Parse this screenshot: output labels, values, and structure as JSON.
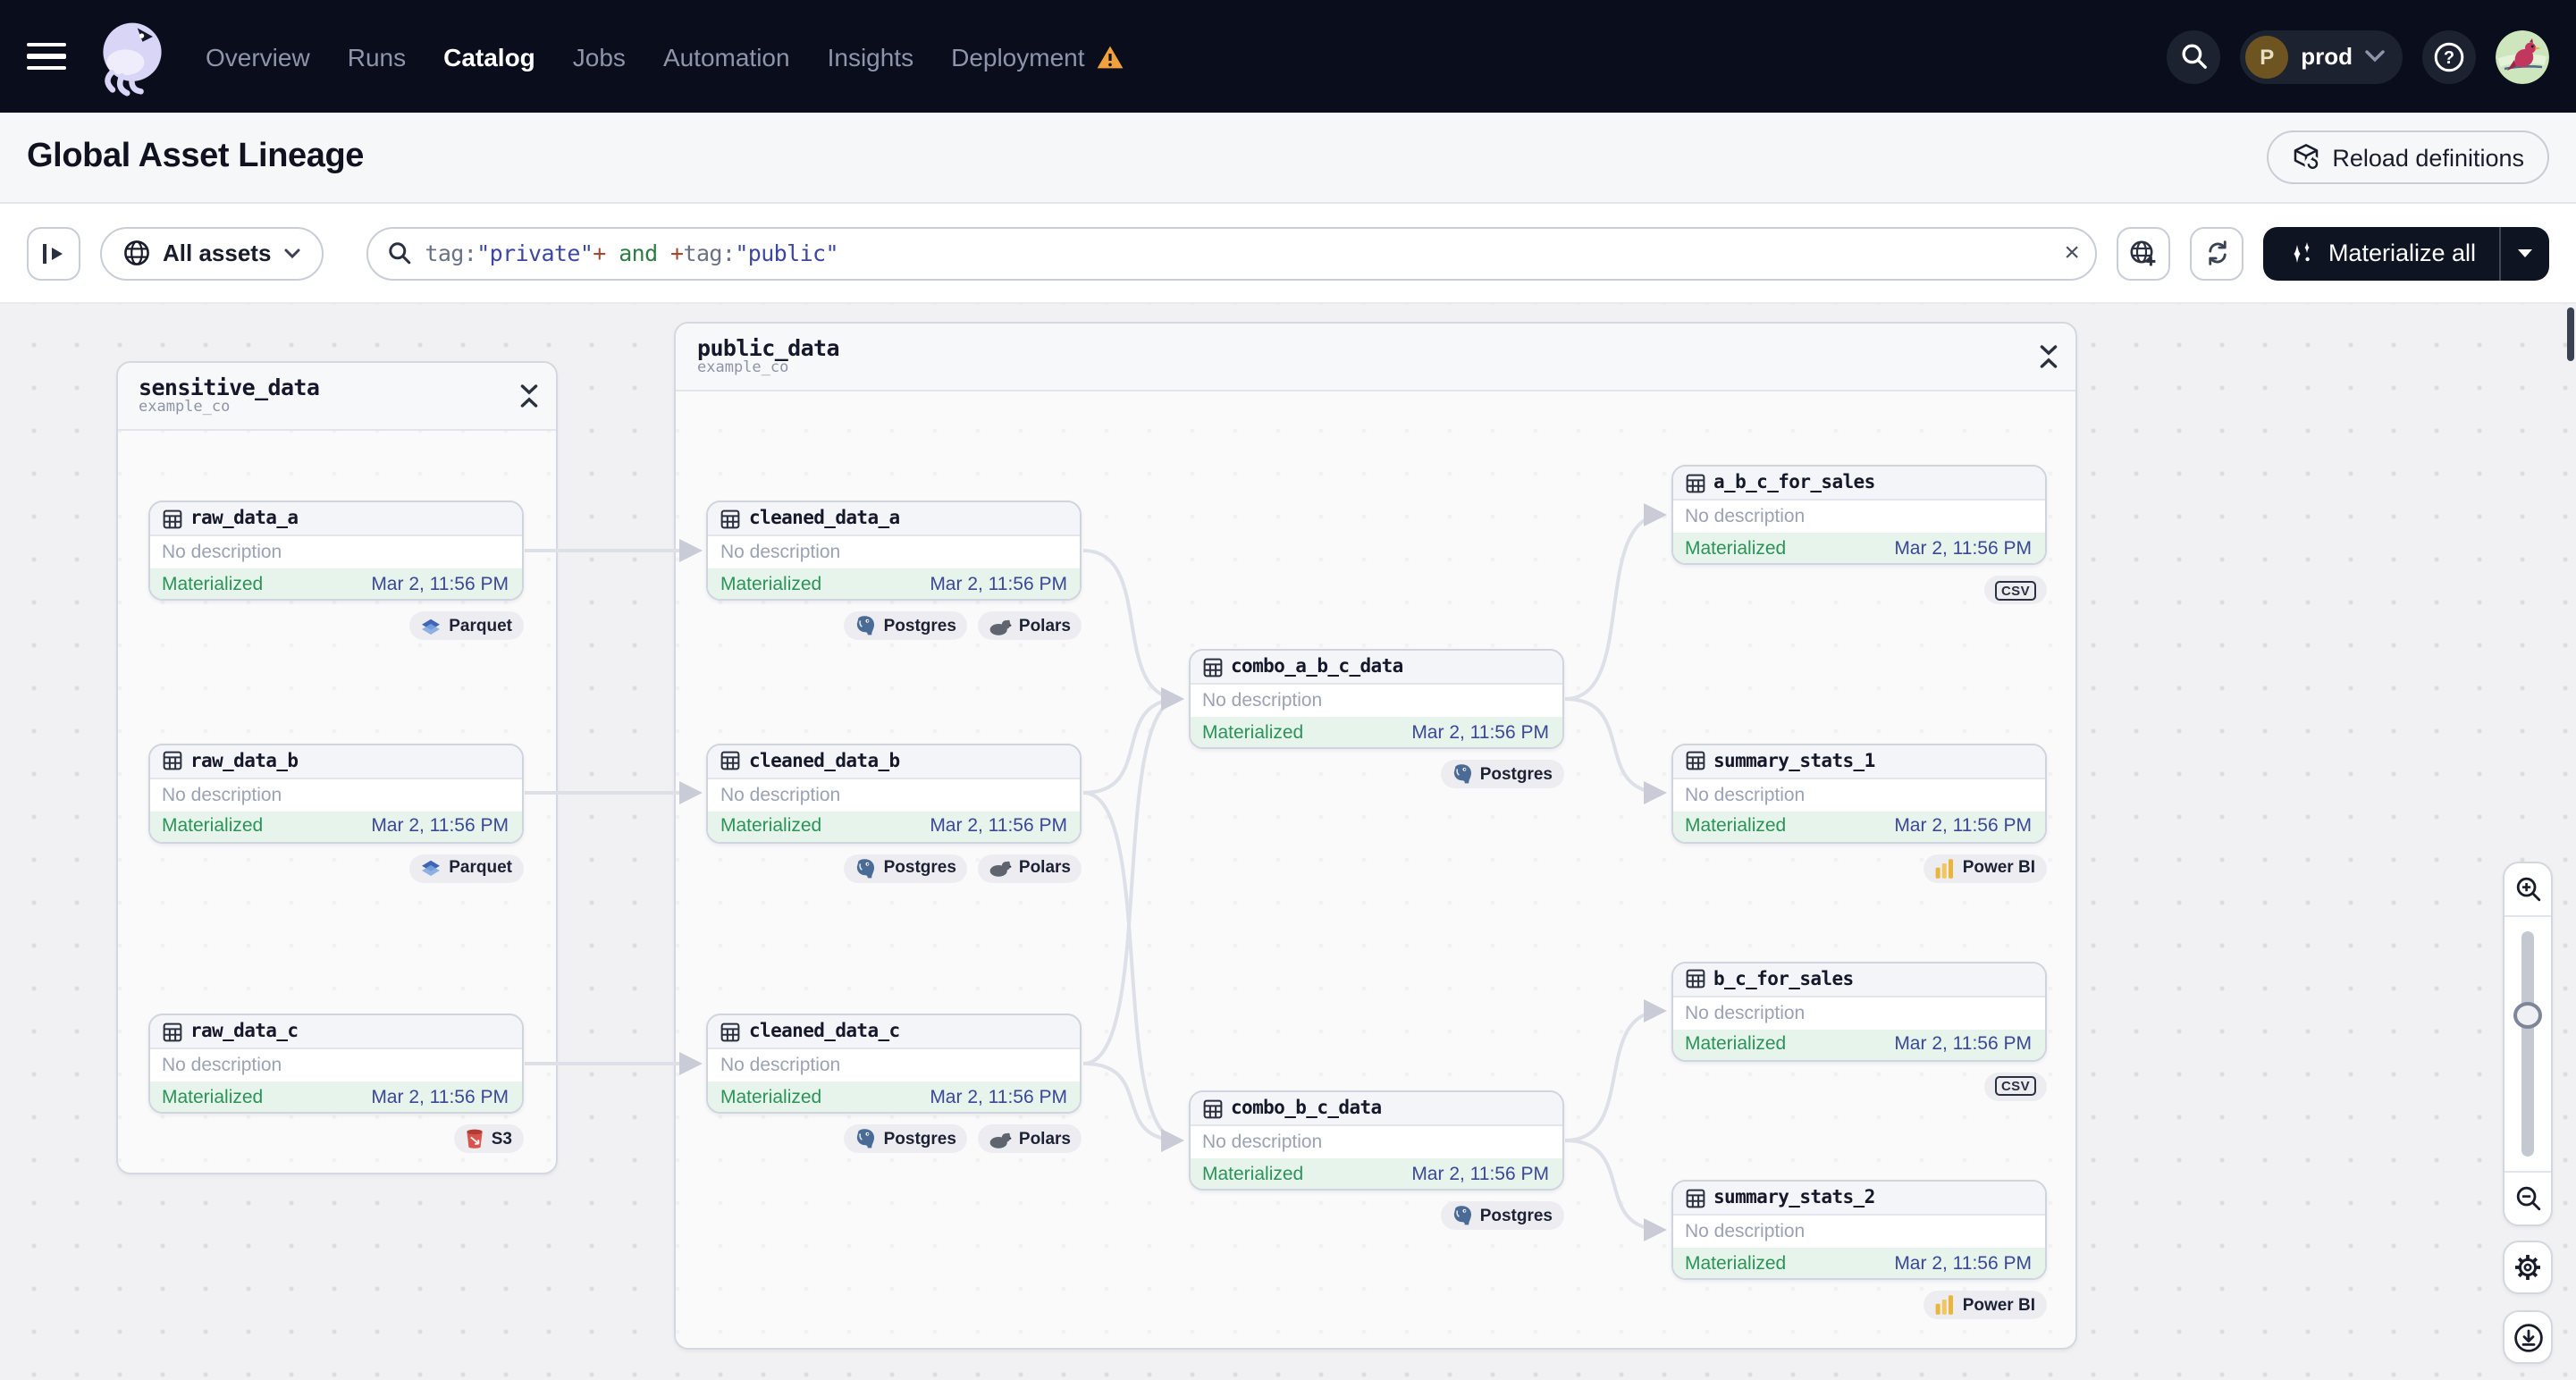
{
  "nav": {
    "menu": [
      {
        "label": "Overview"
      },
      {
        "label": "Runs"
      },
      {
        "label": "Catalog",
        "active": true
      },
      {
        "label": "Jobs"
      },
      {
        "label": "Automation"
      },
      {
        "label": "Insights"
      },
      {
        "label": "Deployment",
        "warning": true
      }
    ],
    "workspace": {
      "initial": "P",
      "name": "prod"
    }
  },
  "page": {
    "title": "Global Asset Lineage",
    "reload_button": "Reload definitions"
  },
  "toolbar": {
    "scope": "All assets",
    "query_tokens": [
      {
        "text": "tag:",
        "color": "#6a7286"
      },
      {
        "text": "\"private\"",
        "color": "#3c47a4"
      },
      {
        "text": "+",
        "color": "#a04a2f"
      },
      {
        "text": " and ",
        "color": "#2e7d46"
      },
      {
        "text": "+",
        "color": "#a04a2f"
      },
      {
        "text": "tag:",
        "color": "#6a7286"
      },
      {
        "text": "\"public\"",
        "color": "#3c47a4"
      }
    ],
    "materialize_button": "Materialize all"
  },
  "graph": {
    "groups": [
      {
        "name": "sensitive_data",
        "subtitle": "example_co"
      },
      {
        "name": "public_data",
        "subtitle": "example_co"
      }
    ],
    "nodes": [
      {
        "name": "raw_data_a",
        "group": "sensitive_data",
        "description": "No description",
        "status": "Materialized",
        "timestamp": "Mar 2, 11:56 PM",
        "badges": [
          "Parquet"
        ]
      },
      {
        "name": "raw_data_b",
        "group": "sensitive_data",
        "description": "No description",
        "status": "Materialized",
        "timestamp": "Mar 2, 11:56 PM",
        "badges": [
          "Parquet"
        ]
      },
      {
        "name": "raw_data_c",
        "group": "sensitive_data",
        "description": "No description",
        "status": "Materialized",
        "timestamp": "Mar 2, 11:56 PM",
        "badges": [
          "S3"
        ]
      },
      {
        "name": "cleaned_data_a",
        "group": "public_data",
        "description": "No description",
        "status": "Materialized",
        "timestamp": "Mar 2, 11:56 PM",
        "badges": [
          "Postgres",
          "Polars"
        ]
      },
      {
        "name": "cleaned_data_b",
        "group": "public_data",
        "description": "No description",
        "status": "Materialized",
        "timestamp": "Mar 2, 11:56 PM",
        "badges": [
          "Postgres",
          "Polars"
        ]
      },
      {
        "name": "cleaned_data_c",
        "group": "public_data",
        "description": "No description",
        "status": "Materialized",
        "timestamp": "Mar 2, 11:56 PM",
        "badges": [
          "Postgres",
          "Polars"
        ]
      },
      {
        "name": "combo_a_b_c_data",
        "group": "public_data",
        "description": "No description",
        "status": "Materialized",
        "timestamp": "Mar 2, 11:56 PM",
        "badges": [
          "Postgres"
        ]
      },
      {
        "name": "combo_b_c_data",
        "group": "public_data",
        "description": "No description",
        "status": "Materialized",
        "timestamp": "Mar 2, 11:56 PM",
        "badges": [
          "Postgres"
        ]
      },
      {
        "name": "a_b_c_for_sales",
        "group": "public_data",
        "description": "No description",
        "status": "Materialized",
        "timestamp": "Mar 2, 11:56 PM",
        "badges": [
          "CSV"
        ]
      },
      {
        "name": "summary_stats_1",
        "group": "public_data",
        "description": "No description",
        "status": "Materialized",
        "timestamp": "Mar 2, 11:56 PM",
        "badges": [
          "Power BI"
        ]
      },
      {
        "name": "b_c_for_sales",
        "group": "public_data",
        "description": "No description",
        "status": "Materialized",
        "timestamp": "Mar 2, 11:56 PM",
        "badges": [
          "CSV"
        ]
      },
      {
        "name": "summary_stats_2",
        "group": "public_data",
        "description": "No description",
        "status": "Materialized",
        "timestamp": "Mar 2, 11:56 PM",
        "badges": [
          "Power BI"
        ]
      }
    ],
    "edges": [
      [
        "raw_data_a",
        "cleaned_data_a"
      ],
      [
        "raw_data_b",
        "cleaned_data_b"
      ],
      [
        "raw_data_c",
        "cleaned_data_c"
      ],
      [
        "cleaned_data_a",
        "combo_a_b_c_data"
      ],
      [
        "cleaned_data_b",
        "combo_a_b_c_data"
      ],
      [
        "cleaned_data_c",
        "combo_a_b_c_data"
      ],
      [
        "cleaned_data_b",
        "combo_b_c_data"
      ],
      [
        "cleaned_data_c",
        "combo_b_c_data"
      ],
      [
        "combo_a_b_c_data",
        "a_b_c_for_sales"
      ],
      [
        "combo_a_b_c_data",
        "summary_stats_1"
      ],
      [
        "combo_b_c_data",
        "b_c_for_sales"
      ],
      [
        "combo_b_c_data",
        "summary_stats_2"
      ]
    ]
  },
  "colors": {
    "nav_bg": "#0a0d1b",
    "materialized_green": "#2c9358",
    "timestamp_blue": "#3c4795",
    "warning_orange": "#f0a03c",
    "edge_gray": "#dee0e7"
  }
}
